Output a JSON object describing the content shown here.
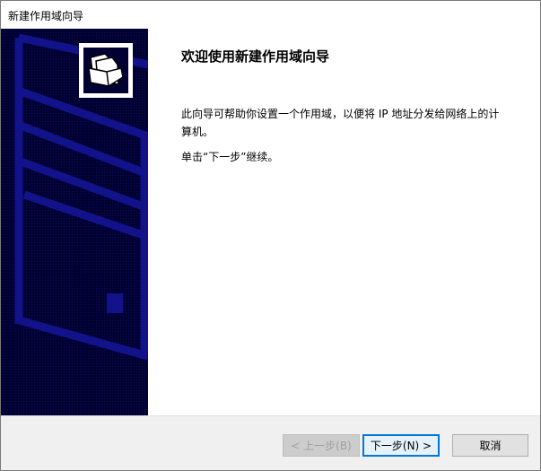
{
  "window": {
    "title": "新建作用域向导"
  },
  "content": {
    "heading": "欢迎使用新建作用域向导",
    "description": "此向导可帮助你设置一个作用域，以便将 IP 地址分发给网络上的计算机。",
    "instruction": "单击“下一步”继续。"
  },
  "buttons": {
    "back": "< 上一步(B)",
    "next": "下一步(N) >",
    "cancel": "取消"
  },
  "icons": {
    "wizard": "folders-icon"
  }
}
